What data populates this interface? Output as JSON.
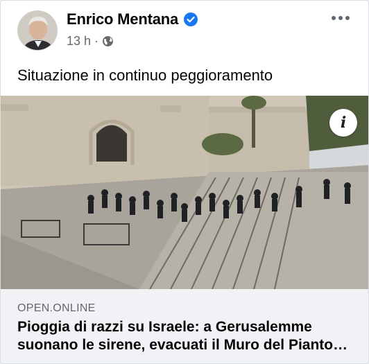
{
  "post": {
    "author": "Enrico Mentana",
    "timestamp": "13 h",
    "separator": "·",
    "audience_icon": "globe-icon",
    "verified_icon": "verified-badge-icon",
    "message": "Situazione in continuo peggioramento",
    "more_icon": "more-options-icon"
  },
  "link": {
    "domain": "OPEN.ONLINE",
    "headline": "Pioggia di razzi su Israele: a Gerusalemme suonano le sirene, evacuati il Muro del Pianto…",
    "info_icon": "info-icon"
  },
  "colors": {
    "verified": "#1877f2",
    "secondary_text": "#65676b",
    "link_footer_bg": "#f0f2f5"
  }
}
